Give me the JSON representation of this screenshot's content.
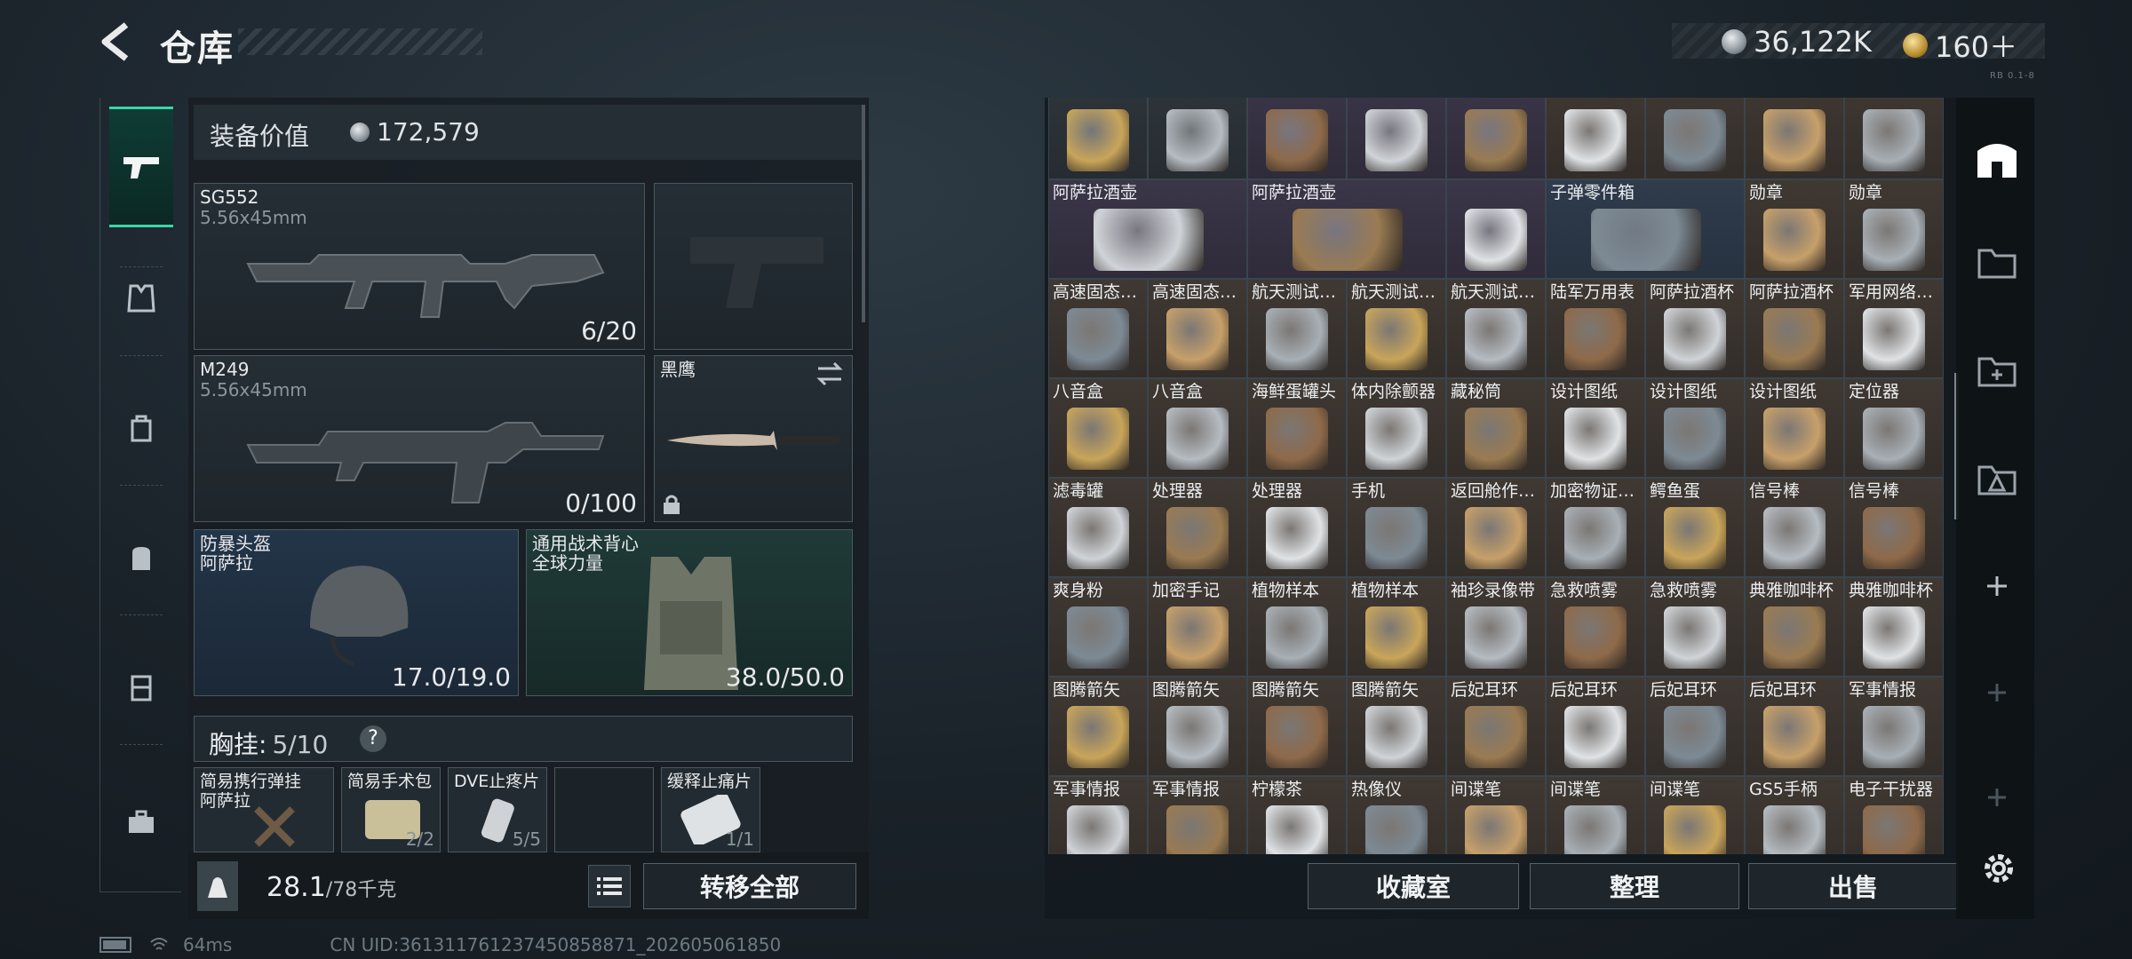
{
  "header": {
    "title": "仓库",
    "currency_silver": "36,122K",
    "currency_gold": "160＋",
    "version_tag": "RB 0.1-8"
  },
  "equipment": {
    "value_label": "装备价值",
    "value": "172,579",
    "primary_1": {
      "name": "SG552",
      "caliber": "5.56x45mm",
      "ammo": "6/20"
    },
    "primary_2": {
      "name": "M249",
      "caliber": "5.56x45mm",
      "ammo": "0/100"
    },
    "melee": {
      "name": "黑鹰"
    },
    "helmet": {
      "name": "防暴头盔",
      "brand": "阿萨拉",
      "durability": "17.0/19.0"
    },
    "vest": {
      "name": "通用战术背心",
      "brand": "全球力量",
      "durability": "38.0/50.0"
    },
    "rig": {
      "label": "胸挂:",
      "count": "5/10",
      "help": "?"
    },
    "rig_items": [
      {
        "name": "简易携行弹挂",
        "sub": "阿萨拉",
        "amt": ""
      },
      {
        "name": "简易手术包",
        "sub": "",
        "amt": "2/2"
      },
      {
        "name": "DVE止疼片",
        "sub": "",
        "amt": "5/5"
      },
      {
        "name": "",
        "sub": "",
        "amt": ""
      },
      {
        "name": "缓释止痛片",
        "sub": "",
        "amt": "1/1"
      }
    ]
  },
  "weight": {
    "current": "28.1",
    "max": "/78千克"
  },
  "buttons": {
    "transfer_all": "转移全部",
    "collection": "收藏室",
    "sort": "整理",
    "sell": "出售"
  },
  "status": {
    "ping": "64ms",
    "uid": "CN UID:361311761237450858871_202605061850"
  },
  "inventory": {
    "rows": [
      [
        {
          "name": "",
          "bg": "dark"
        },
        {
          "name": "",
          "bg": "dark"
        },
        {
          "name": "",
          "bg": "purple"
        },
        {
          "name": "",
          "bg": "purple"
        },
        {
          "name": "",
          "bg": "purple"
        },
        {
          "name": "",
          "bg": "brown"
        },
        {
          "name": "",
          "bg": "brown"
        },
        {
          "name": "",
          "bg": "brown"
        },
        {
          "name": "",
          "bg": "brown"
        }
      ],
      [
        {
          "name": "阿萨拉酒壶",
          "bg": "purple",
          "wide": true
        },
        {
          "name": "阿萨拉酒壶",
          "bg": "purple",
          "wide": true
        },
        {
          "name": "",
          "bg": "purple"
        },
        {
          "name": "子弹零件箱",
          "bg": "blue",
          "wide": true
        },
        {
          "name": "勋章",
          "bg": "brown"
        },
        {
          "name": "勋章",
          "bg": "brown"
        }
      ],
      [
        {
          "name": "高速固态…",
          "bg": "brown"
        },
        {
          "name": "高速固态…",
          "bg": "brown"
        },
        {
          "name": "航天测试…",
          "bg": "brown"
        },
        {
          "name": "航天测试…",
          "bg": "brown"
        },
        {
          "name": "航天测试…",
          "bg": "brown"
        },
        {
          "name": "陆军万用表",
          "bg": "brown"
        },
        {
          "name": "阿萨拉酒杯",
          "bg": "brown"
        },
        {
          "name": "阿萨拉酒杯",
          "bg": "brown"
        },
        {
          "name": "军用网络…",
          "bg": "brown"
        }
      ],
      [
        {
          "name": "八音盒",
          "bg": "brown"
        },
        {
          "name": "八音盒",
          "bg": "brown"
        },
        {
          "name": "海鲜蛋罐头",
          "bg": "brown"
        },
        {
          "name": "体内除颤器",
          "bg": "brown"
        },
        {
          "name": "藏秘筒",
          "bg": "brown"
        },
        {
          "name": "设计图纸",
          "bg": "brown"
        },
        {
          "name": "设计图纸",
          "bg": "brown"
        },
        {
          "name": "设计图纸",
          "bg": "brown"
        },
        {
          "name": "定位器",
          "bg": "brown"
        }
      ],
      [
        {
          "name": "滤毒罐",
          "bg": "brown"
        },
        {
          "name": "处理器",
          "bg": "brown"
        },
        {
          "name": "处理器",
          "bg": "brown"
        },
        {
          "name": "手机",
          "bg": "brown"
        },
        {
          "name": "返回舱作…",
          "bg": "brown"
        },
        {
          "name": "加密物证…",
          "bg": "brown"
        },
        {
          "name": "鳄鱼蛋",
          "bg": "brown"
        },
        {
          "name": "信号棒",
          "bg": "brown"
        },
        {
          "name": "信号棒",
          "bg": "brown"
        }
      ],
      [
        {
          "name": "爽身粉",
          "bg": "brown"
        },
        {
          "name": "加密手记",
          "bg": "brown"
        },
        {
          "name": "植物样本",
          "bg": "brown"
        },
        {
          "name": "植物样本",
          "bg": "brown"
        },
        {
          "name": "袖珍录像带",
          "bg": "brown"
        },
        {
          "name": "急救喷雾",
          "bg": "brown"
        },
        {
          "name": "急救喷雾",
          "bg": "brown"
        },
        {
          "name": "典雅咖啡杯",
          "bg": "brown"
        },
        {
          "name": "典雅咖啡杯",
          "bg": "brown"
        }
      ],
      [
        {
          "name": "图腾箭矢",
          "bg": "brown"
        },
        {
          "name": "图腾箭矢",
          "bg": "brown"
        },
        {
          "name": "图腾箭矢",
          "bg": "brown"
        },
        {
          "name": "图腾箭矢",
          "bg": "brown"
        },
        {
          "name": "后妃耳环",
          "bg": "brown"
        },
        {
          "name": "后妃耳环",
          "bg": "brown"
        },
        {
          "name": "后妃耳环",
          "bg": "brown"
        },
        {
          "name": "后妃耳环",
          "bg": "brown"
        },
        {
          "name": "军事情报",
          "bg": "brown"
        }
      ],
      [
        {
          "name": "军事情报",
          "bg": "brown"
        },
        {
          "name": "军事情报",
          "bg": "brown"
        },
        {
          "name": "柠檬茶",
          "bg": "brown"
        },
        {
          "name": "热像仪",
          "bg": "brown"
        },
        {
          "name": "间谍笔",
          "bg": "brown"
        },
        {
          "name": "间谍笔",
          "bg": "brown"
        },
        {
          "name": "间谍笔",
          "bg": "brown"
        },
        {
          "name": "GS5手柄",
          "bg": "brown"
        },
        {
          "name": "电子干扰器",
          "bg": "brown"
        }
      ]
    ]
  },
  "colors": {
    "accent": "#3bd6a6",
    "panel": "#1e262c"
  }
}
